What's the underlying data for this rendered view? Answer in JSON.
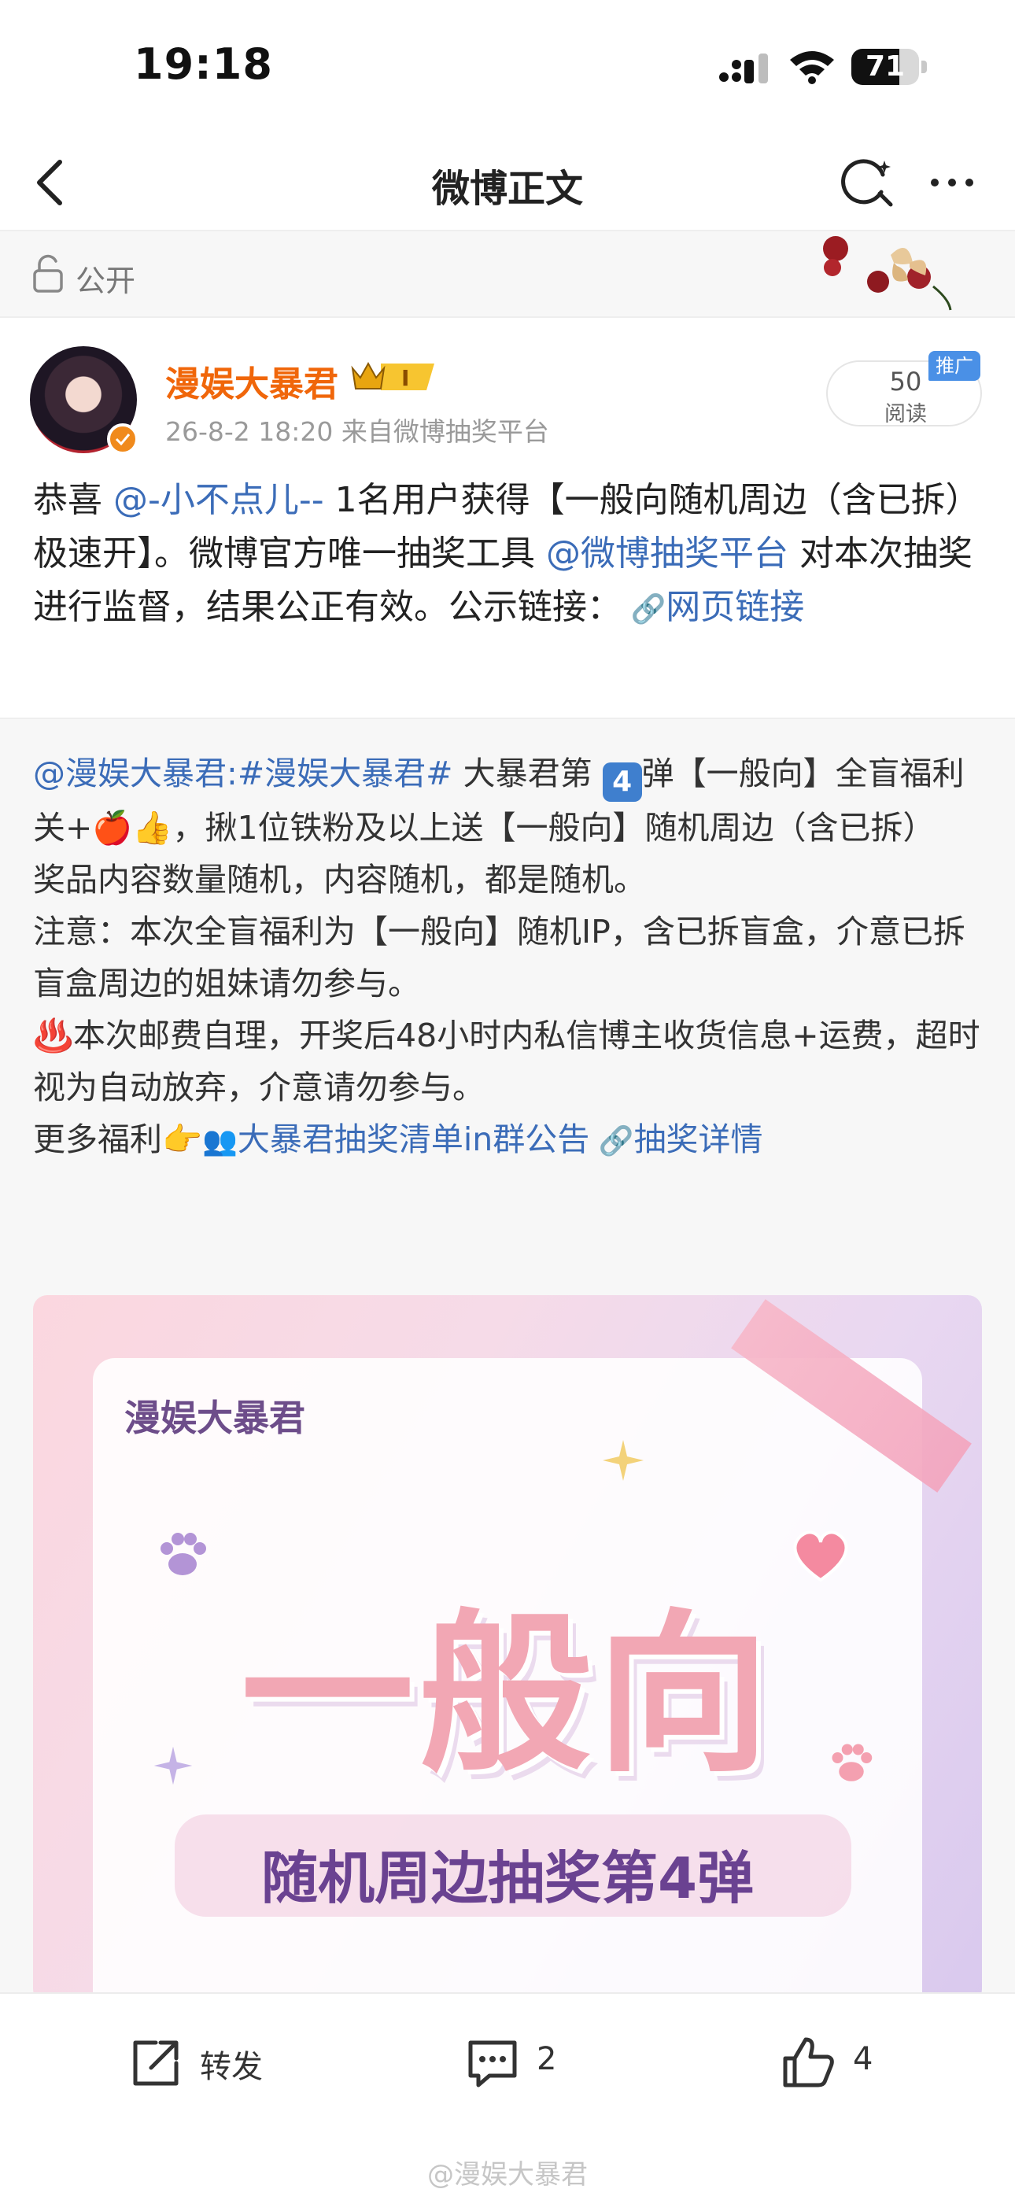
{
  "status_bar": {
    "time": "19:18",
    "battery": "71",
    "battery_level": 0.71
  },
  "nav": {
    "title": "微博正文"
  },
  "visibility": {
    "label": "公开"
  },
  "post": {
    "author": "漫娱大暴君",
    "meta": "26-8-2 18:20  来自微博抽奖平台",
    "read_count": "50",
    "read_label": "阅读",
    "ad_tag": "推广",
    "text": {
      "p1": "恭喜 ",
      "mention1": "@-小不点儿--",
      "p2": " 1名用户获得【一般向随机周边（含已拆）极速开】。微博官方唯一抽奖工具 ",
      "mention2": "@微博抽奖平台",
      "p3": " 对本次抽奖进行监督，结果公正有效。公示链接：",
      "link": "网页链接"
    }
  },
  "repost": {
    "author_mention": "@漫娱大暴君:",
    "topic": "#漫娱大暴君#",
    "line1_a": " 大暴君第 ",
    "number_emoji": "4",
    "line1_b": "弹【一般向】全盲福利",
    "line2": "关+🍎👍，揪1位铁粉及以上送【一般向】随机周边（含已拆）",
    "line3": "奖品内容数量随机，内容随机，都是随机。",
    "line4": "注意：本次全盲福利为【一般向】随机IP，含已拆盲盒，介意已拆盲盒周边的姐妹请勿参与。",
    "line5": "♨️本次邮费自理，开奖后48小时内私信博主收货信息+运费，超时视为自动放弃，介意请勿参与。",
    "line6_prefix": "更多福利👉",
    "group_link": "大暴君抽奖清单in群公告",
    "detail_link": "抽奖详情",
    "poster": {
      "brand": "漫娱大暴君",
      "title": "一般向",
      "subtitle": "随机周边抽奖第4弹"
    }
  },
  "actions": {
    "repost_label": "转发",
    "comment_count": "2",
    "like_count": "4"
  },
  "watermark": "@漫娱大暴君"
}
